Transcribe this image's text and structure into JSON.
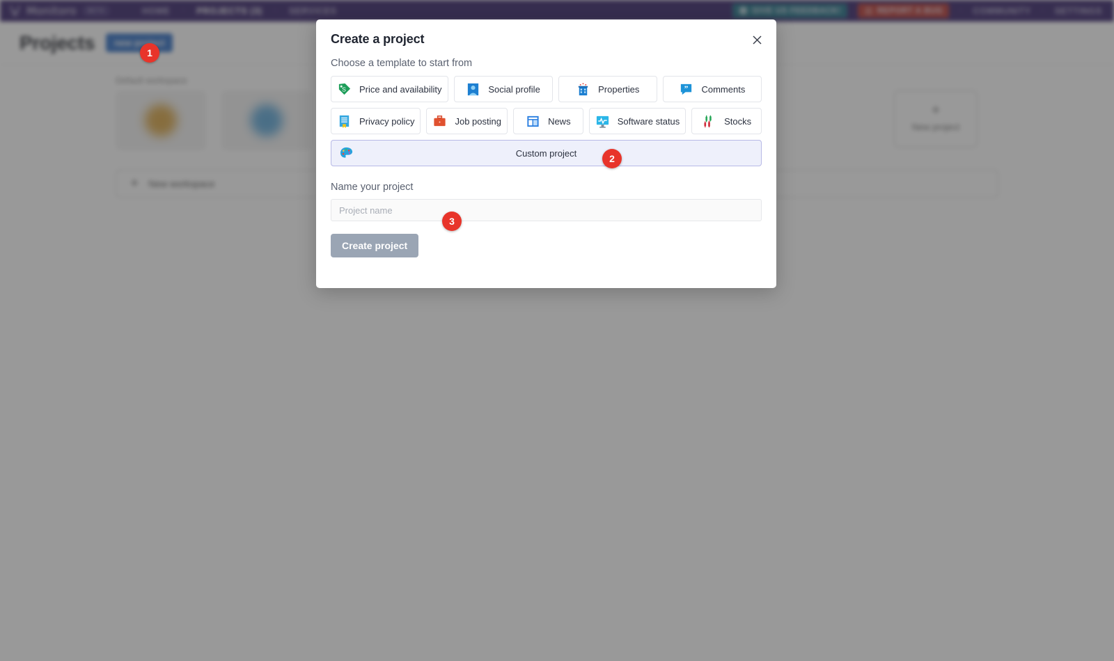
{
  "navbar": {
    "brand": "Monitoro",
    "beta": "BETA",
    "logo_icon": "bull-head-icon",
    "links": [
      {
        "label": "HOME",
        "active": false
      },
      {
        "label": "PROJECTS (3)",
        "active": true
      },
      {
        "label": "SERVICES",
        "active": false
      }
    ],
    "separator": "·",
    "feedback_button": {
      "label": "GIVE US FEEDBACK!",
      "icon": "speech-bubble-icon",
      "color": "#1b6e84"
    },
    "bug_button": {
      "label": "REPORT A BUG",
      "icon": "bug-icon",
      "color": "#b6342f"
    },
    "right_links": [
      {
        "label": "COMMUNITY"
      },
      {
        "label": "SETTINGS"
      }
    ],
    "background_color": "#342068"
  },
  "page": {
    "title": "Projects",
    "new_project_button": "new project",
    "workspace_label": "Default workspace",
    "new_project_card": {
      "label": "New project",
      "icon": "plus-icon"
    },
    "new_workspace": {
      "label": "New workspace",
      "icon": "plus-icon"
    },
    "card_blobs": [
      "#d9a441",
      "#5aa6d8",
      "#f0f0f0",
      "#4f9e5a",
      "#5aa6d8",
      "#4f9e5a"
    ]
  },
  "modal": {
    "title": "Create a project",
    "close_icon": "close-icon",
    "template_label": "Choose a template to start from",
    "templates_row1": [
      {
        "label": "Price and availability",
        "icon": "price-tag-icon"
      },
      {
        "label": "Social profile",
        "icon": "user-portrait-icon"
      },
      {
        "label": "Properties",
        "icon": "building-icon"
      },
      {
        "label": "Comments",
        "icon": "quote-bubble-icon"
      }
    ],
    "templates_row2": [
      {
        "label": "Privacy policy",
        "icon": "document-icon"
      },
      {
        "label": "Job posting",
        "icon": "briefcase-icon"
      },
      {
        "label": "News",
        "icon": "layout-icon"
      },
      {
        "label": "Software status",
        "icon": "monitor-pulse-icon"
      },
      {
        "label": "Stocks",
        "icon": "candlestick-icon"
      }
    ],
    "custom_template": {
      "label": "Custom project",
      "icon": "palette-icon",
      "selected": true
    },
    "name_label": "Name your project",
    "name_input": {
      "value": "",
      "placeholder": "Project name"
    },
    "create_button": {
      "label": "Create project",
      "disabled": true
    }
  },
  "annotations": [
    {
      "number": "1",
      "target": "new-project-button"
    },
    {
      "number": "2",
      "target": "custom-project-template"
    },
    {
      "number": "3",
      "target": "project-name-input"
    }
  ]
}
